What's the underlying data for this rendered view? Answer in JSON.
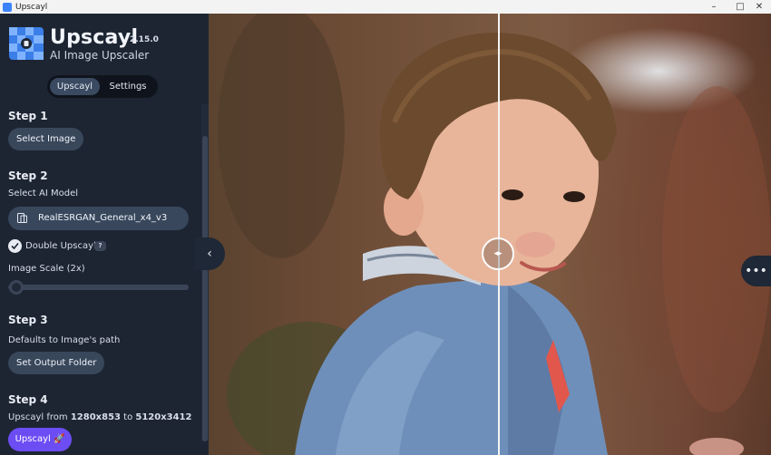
{
  "window": {
    "title": "Upscayl",
    "minimize": "–",
    "maximize": "□",
    "close": "✕"
  },
  "app": {
    "name": "Upscayl",
    "version": "2.15.0",
    "tagline": "AI Image Upscaler"
  },
  "tabs": [
    {
      "label": "Upscayl",
      "active": true
    },
    {
      "label": "Settings",
      "active": false
    }
  ],
  "step1": {
    "title": "Step 1",
    "button": "Select Image"
  },
  "step2": {
    "title": "Step 2",
    "model_label": "Select AI Model",
    "model_value": "RealESRGAN_General_x4_v3",
    "double_upscayl": {
      "label": "Double Upscayl",
      "checked": true,
      "help": "?"
    },
    "scale_label": "Image Scale (2x)",
    "scale_level": 0
  },
  "step3": {
    "title": "Step 3",
    "description": "Defaults to Image's path",
    "button": "Set Output Folder"
  },
  "step4": {
    "title": "Step 4",
    "prefix": "Upscayl from ",
    "from": "1280x853",
    "middle": " to ",
    "to": "5120x3412",
    "button": "Upscayl 🚀"
  },
  "viewer": {
    "collapse_icon": "‹",
    "compare_icon": "◂▸",
    "more_icon": "•••"
  },
  "colors": {
    "sidebar": "#1d2533",
    "accent": "#6c4df4",
    "button": "#39475b"
  }
}
